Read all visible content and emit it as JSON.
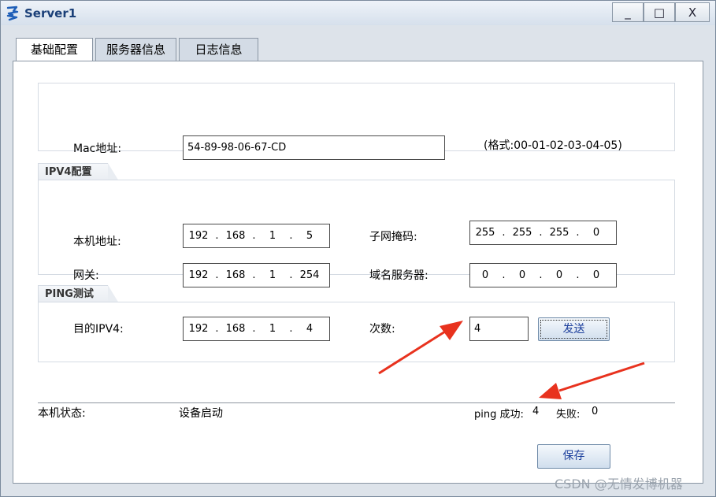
{
  "window": {
    "title": "Server1",
    "minimize_glyph": "_",
    "maximize_glyph": "□",
    "close_glyph": "X"
  },
  "tabs": [
    {
      "label": "基础配置",
      "active": true
    },
    {
      "label": "服务器信息",
      "active": false
    },
    {
      "label": "日志信息",
      "active": false
    }
  ],
  "mac": {
    "label": "Mac地址:",
    "value": "54-89-98-06-67-CD",
    "hint": "(格式:00-01-02-03-04-05)"
  },
  "ipv4": {
    "group_title": "IPV4配置",
    "local_address_label": "本机地址:",
    "local_address": [
      "192",
      "168",
      "1",
      "5"
    ],
    "subnet_mask_label": "子网掩码:",
    "subnet_mask": [
      "255",
      "255",
      "255",
      "0"
    ],
    "gateway_label": "网关:",
    "gateway": [
      "192",
      "168",
      "1",
      "254"
    ],
    "dns_label": "域名服务器:",
    "dns": [
      "0",
      "0",
      "0",
      "0"
    ]
  },
  "ping": {
    "group_title": "PING测试",
    "target_label": "目的IPV4:",
    "target": [
      "192",
      "168",
      "1",
      "4"
    ],
    "count_label": "次数:",
    "count": "4",
    "send_label": "发送"
  },
  "status": {
    "label": "本机状态:",
    "value": "设备启动",
    "success_label": "ping 成功:",
    "success_count": "4",
    "fail_label": "失败:",
    "fail_count": "0"
  },
  "save_label": "保存",
  "watermark": "CSDN @无情发博机器",
  "colors": {
    "arrow": "#e8321e",
    "button_text": "#1c3f9c",
    "title_text": "#1a3f78"
  }
}
